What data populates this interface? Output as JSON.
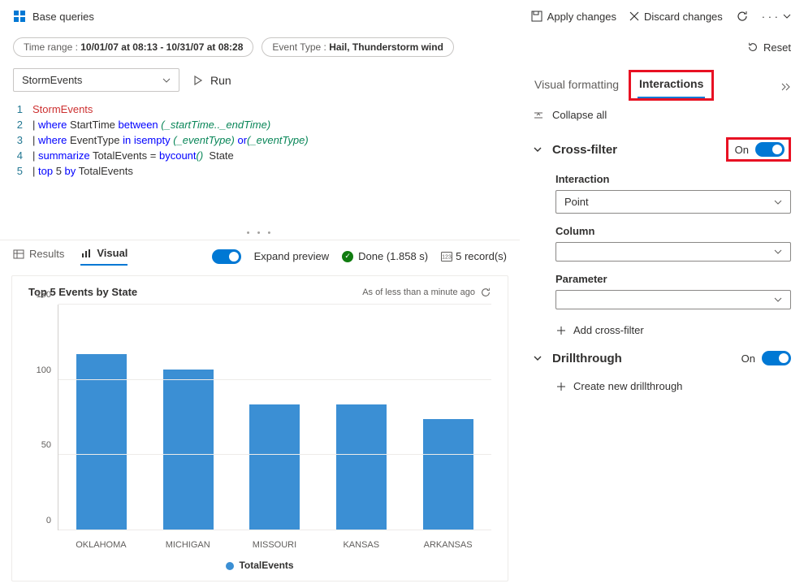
{
  "header": {
    "title": "Base queries",
    "apply": "Apply changes",
    "discard": "Discard changes"
  },
  "filters": {
    "time_label": "Time range : ",
    "time_value": "10/01/07 at 08:13 - 10/31/07 at 08:28",
    "event_label": "Event Type : ",
    "event_value": "Hail, Thunderstorm wind",
    "reset": "Reset"
  },
  "query": {
    "source": "StormEvents",
    "run": "Run",
    "lines": [
      {
        "n": "1",
        "pre": "",
        "ident": "StormEvents",
        "rest": ""
      },
      {
        "n": "2",
        "pre": "| ",
        "kw": "where",
        "mid": " StartTime ",
        "op": "between",
        "args": " (_startTime.._endTime)"
      },
      {
        "n": "3",
        "pre": "| ",
        "kw": "where",
        "mid": " EventType ",
        "op": "in",
        "args": " (_eventType) ",
        "op2": "or",
        "f": " isempty",
        "args2": "(_eventType)"
      },
      {
        "n": "4",
        "pre": "| ",
        "kw": "summarize",
        "mid": " TotalEvents = ",
        "f": "count",
        "args": "() ",
        "op": "by",
        "rest": " State"
      },
      {
        "n": "5",
        "pre": "| ",
        "kw": "top",
        "mid": " 5 ",
        "op": "by",
        "rest": " TotalEvents"
      }
    ]
  },
  "results": {
    "tab_results": "Results",
    "tab_visual": "Visual",
    "expand": "Expand preview",
    "status": "Done (1.858 s)",
    "records": "5 record(s)"
  },
  "chart_data": {
    "type": "bar",
    "title": "Top 5 Events by State",
    "subtitle": "As of less than a minute ago",
    "ylim": [
      0,
      150
    ],
    "yticks": [
      0,
      50,
      100,
      150
    ],
    "categories": [
      "OKLAHOMA",
      "MICHIGAN",
      "MISSOURI",
      "KANSAS",
      "ARKANSAS"
    ],
    "values": [
      131,
      120,
      94,
      94,
      83
    ],
    "legend": "TotalEvents"
  },
  "right": {
    "tab_visual": "Visual formatting",
    "tab_inter": "Interactions",
    "collapse": "Collapse all",
    "crossfilter": "Cross-filter",
    "on": "On",
    "interaction_label": "Interaction",
    "interaction_value": "Point",
    "column_label": "Column",
    "column_value": "",
    "param_label": "Parameter",
    "param_value": "",
    "add_cf": "Add cross-filter",
    "drill": "Drillthrough",
    "drill_on": "On",
    "add_drill": "Create new drillthrough"
  }
}
